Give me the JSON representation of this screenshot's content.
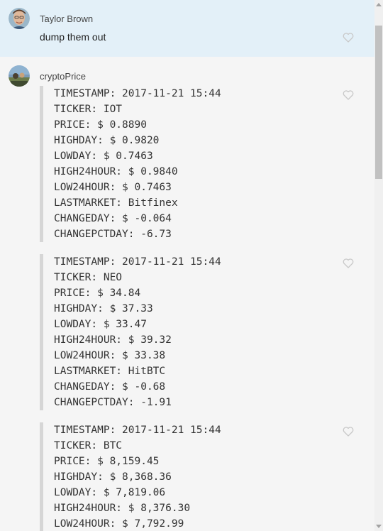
{
  "colors": {
    "highlight_bg": "#e3f0f8",
    "page_bg": "#f5f5f5",
    "quote_bar": "#d6d6d6",
    "heart_stroke": "#c8c8c8"
  },
  "messages": [
    {
      "sender": "Taylor Brown",
      "text": "dump them out",
      "highlighted": true
    },
    {
      "sender": "cryptoPrice",
      "blocks": [
        {
          "lines": [
            "TIMESTAMP: 2017-11-21 15:44",
            "TICKER: IOT",
            "PRICE: $ 0.8890",
            "HIGHDAY: $ 0.9820",
            "LOWDAY: $ 0.7463",
            "HIGH24HOUR: $ 0.9840",
            "LOW24HOUR: $ 0.7463",
            "LASTMARKET: Bitfinex",
            "CHANGEDAY: $ -0.064",
            "CHANGEPCTDAY: -6.73"
          ]
        },
        {
          "lines": [
            "TIMESTAMP: 2017-11-21 15:44",
            "TICKER: NEO",
            "PRICE: $ 34.84",
            "HIGHDAY: $ 37.33",
            "LOWDAY: $ 33.47",
            "HIGH24HOUR: $ 39.32",
            "LOW24HOUR: $ 33.38",
            "LASTMARKET: HitBTC",
            "CHANGEDAY: $ -0.68",
            "CHANGEPCTDAY: -1.91"
          ]
        },
        {
          "lines": [
            "TIMESTAMP: 2017-11-21 15:44",
            "TICKER: BTC",
            "PRICE: $ 8,159.45",
            "HIGHDAY: $ 8,368.36",
            "LOWDAY: $ 7,819.06",
            "HIGH24HOUR: $ 8,376.30",
            "LOW24HOUR: $ 7,792.99"
          ]
        }
      ]
    }
  ],
  "icons": {
    "like": "heart-outline-icon",
    "scroll_up": "arrow-up-icon",
    "scroll_down": "arrow-down-icon"
  }
}
